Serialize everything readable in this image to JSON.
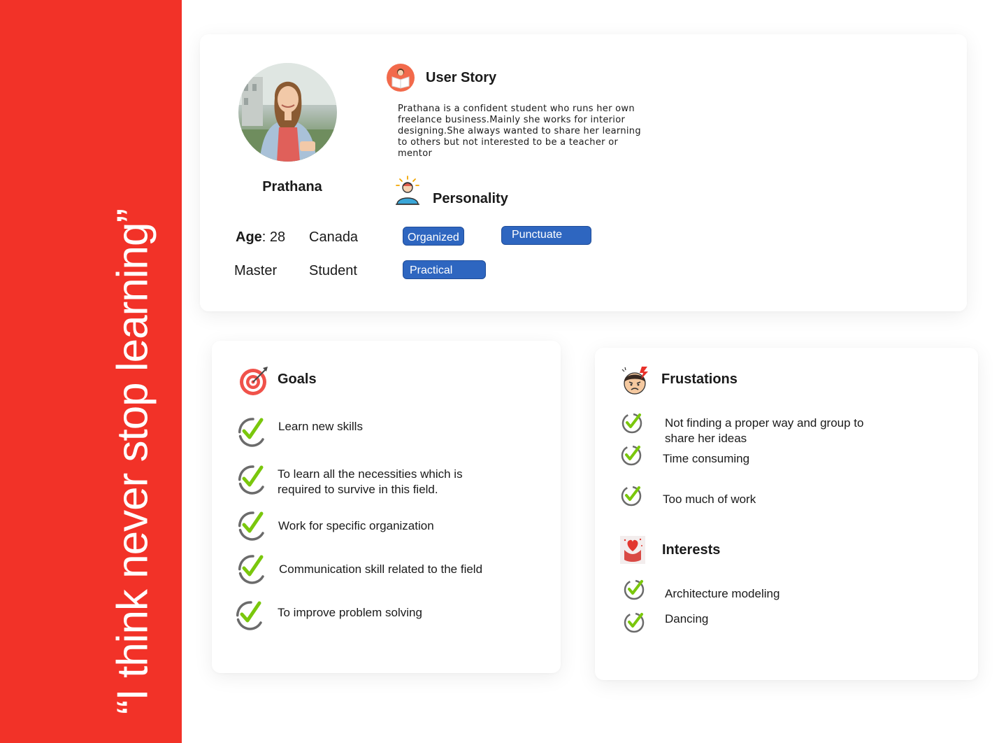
{
  "quote": "“I think never stop learning”",
  "profile": {
    "name": "Prathana",
    "age_label": "Age",
    "age_sep": ":",
    "age_value": "28",
    "country": "Canada",
    "degree": "Master",
    "occupation": "Student"
  },
  "user_story": {
    "title": "User Story",
    "text": "Prathana  is a  confident  student who runs her own freelance business.Mainly she works for interior designing.She always wanted to share her learning to others but not interested to be a teacher or mentor"
  },
  "personality": {
    "title": "Personality",
    "traits": [
      "Organized",
      "Punctuate",
      "Practical"
    ]
  },
  "goals": {
    "title": "Goals",
    "items": [
      "Learn new skills",
      "To learn all the necessities which is required to survive in this field.",
      "Work for specific organization",
      "Communication skill related to the field",
      "To improve problem solving"
    ]
  },
  "frustrations": {
    "title": "Frustations",
    "items": [
      "Not finding a proper way and group to share her ideas",
      "Time consuming",
      "Too much of work"
    ]
  },
  "interests": {
    "title": "Interests",
    "items": [
      "Architecture modeling",
      "Dancing"
    ]
  },
  "colors": {
    "sidebar": "#f23228",
    "tag": "#2e66c0",
    "check_green": "#7ac70c",
    "check_gray": "#6b6b6b"
  },
  "icons": [
    "reading-icon",
    "personality-icon",
    "target-icon",
    "frustrated-face-icon",
    "heart-hands-icon",
    "checkmark-icon"
  ]
}
